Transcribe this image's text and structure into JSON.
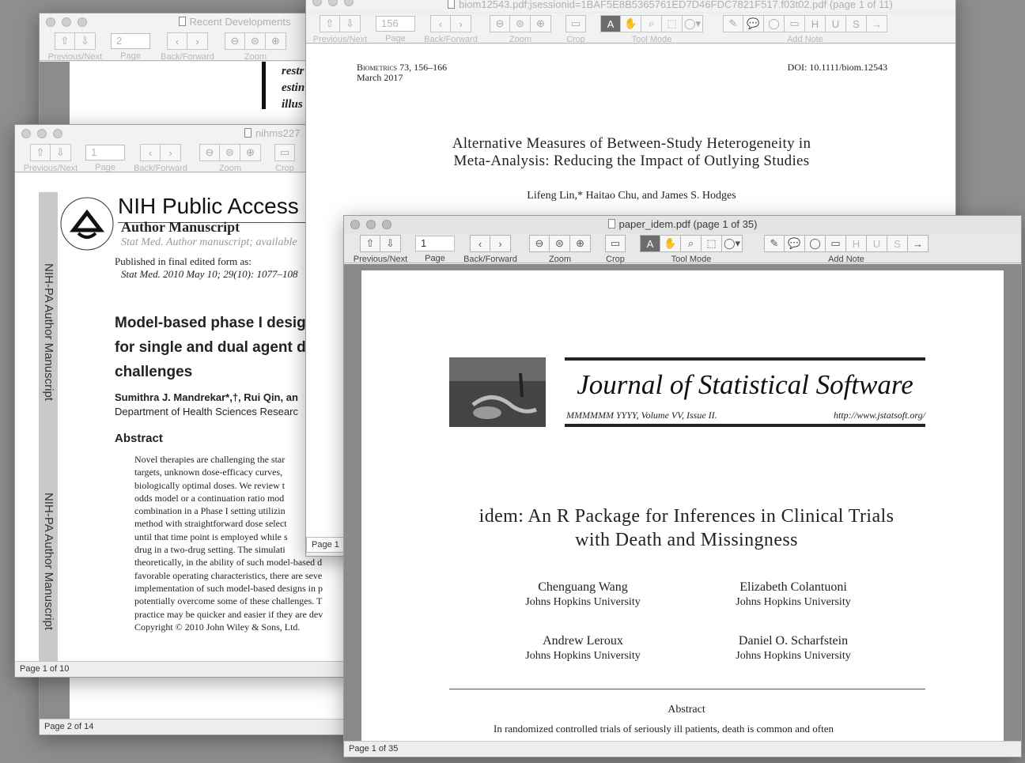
{
  "toolbar_labels": {
    "prev_next": "Previous/Next",
    "page": "Page",
    "back_forward": "Back/Forward",
    "zoom": "Zoom",
    "crop": "Crop",
    "tool_mode": "Tool Mode",
    "add_note": "Add Note"
  },
  "windows": {
    "recent": {
      "title": "Recent Developments",
      "page_value": "2",
      "status": "Page 2 of 14",
      "page_text": [
        "restr",
        "estin",
        "illus"
      ]
    },
    "nihms": {
      "title": "nihms227",
      "page_value": "1",
      "status": "Page 1 of 10",
      "header_title": "NIH Public Access",
      "author_manuscript": "Author Manuscript",
      "stat_med_line": "Stat Med. Author manuscript; available",
      "published_line": "Published in final edited form as:",
      "citation": "Stat Med. 2010 May 10; 29(10): 1077–108",
      "side_text": "NIH-PA Author Manuscript",
      "logo_text": "NATIONAL INSTITUTES OF HEALTH",
      "title_lines": [
        "Model-based phase I desig",
        "for single and dual agent d",
        "challenges"
      ],
      "authors": "Sumithra J. Mandrekar*,†, Rui Qin, an",
      "affiliation": "Department of Health Sciences Researc",
      "abstract_heading": "Abstract",
      "abstract_lines": [
        "Novel therapies are challenging the star",
        "targets, unknown dose-efficacy curves,",
        "biologically optimal doses. We review t",
        "odds model or a continuation ratio mod",
        "combination in a Phase I setting utilizin",
        "method with straightforward dose select",
        "until that time point is employed while s",
        "drug in a two-drug setting. The simulati",
        "theoretically, in the ability of such model-based d",
        "favorable operating characteristics, there are seve",
        "implementation of such model-based designs in p",
        "potentially overcome some of these challenges. T",
        "practice may be quicker and easier if they are dev",
        "Copyright © 2010 John Wiley & Sons, Ltd."
      ]
    },
    "biom": {
      "title": "biom12543.pdf;jsessionid=1BAF5E8B5365761ED7D46FDC7821F517.f03t02.pdf (page 1 of 11)",
      "page_value": "156",
      "status_partial": "Page 1 o",
      "journal_line1": "Biometrics 73, 156–166",
      "journal_line2": "March 2017",
      "doi": "DOI: 10.1111/biom.12543",
      "title_lines": [
        "Alternative Measures of Between-Study Heterogeneity in",
        "Meta-Analysis: Reducing the Impact of Outlying Studies"
      ],
      "authors": "Lifeng Lin,* Haitao Chu, and James S. Hodges"
    },
    "idem": {
      "title": "paper_idem.pdf (page 1 of 35)",
      "page_value": "1",
      "status": "Page 1 of 35",
      "jss_title": "Journal of Statistical Software",
      "jss_meta": "MMMMMM YYYY, Volume VV, Issue II.",
      "jss_url": "http://www.jstatsoft.org/",
      "paper_title_lines": [
        "idem:  An R Package for Inferences in Clinical Trials",
        "with Death and Missingness"
      ],
      "authors": [
        {
          "name": "Chenguang Wang",
          "affiliation": "Johns Hopkins University"
        },
        {
          "name": "Elizabeth Colantuoni",
          "affiliation": "Johns Hopkins University"
        },
        {
          "name": "Andrew Leroux",
          "affiliation": "Johns Hopkins University"
        },
        {
          "name": "Daniel O. Scharfstein",
          "affiliation": "Johns Hopkins University"
        }
      ],
      "abstract_heading": "Abstract",
      "abstract_first_line": "In randomized controlled trials of seriously ill patients, death is common and often"
    }
  }
}
